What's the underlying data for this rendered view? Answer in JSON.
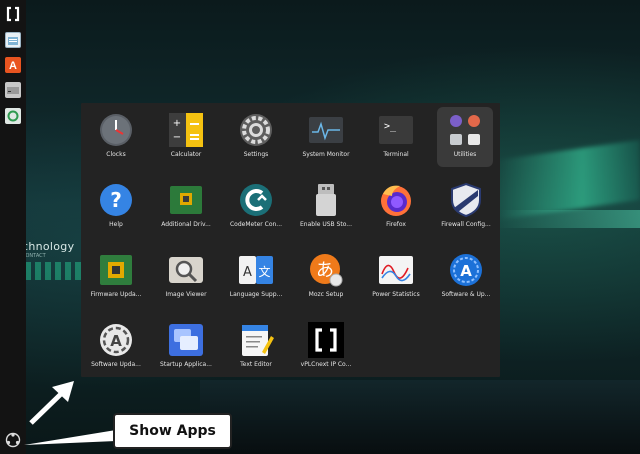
{
  "wallpaper": {
    "brand_text": "chnology",
    "sub_text": "CONTACT"
  },
  "dock": {
    "items": [
      {
        "name": "vPLCnext",
        "icon": "vplcnext-logo-icon"
      },
      {
        "name": "Files",
        "icon": "files-icon"
      },
      {
        "name": "Ubuntu Software",
        "icon": "ubuntu-store-icon"
      },
      {
        "name": "Drive",
        "icon": "disk-icon"
      },
      {
        "name": "Trash",
        "icon": "trash-icon"
      }
    ],
    "show_apps_icon": "show-apps-icon"
  },
  "apps": [
    {
      "label": "Clocks",
      "icon": "clock-icon"
    },
    {
      "label": "Calculator",
      "icon": "calculator-icon"
    },
    {
      "label": "Settings",
      "icon": "gear-icon"
    },
    {
      "label": "System Monitor",
      "icon": "system-monitor-icon"
    },
    {
      "label": "Terminal",
      "icon": "terminal-icon"
    },
    {
      "label": "Utilities",
      "icon": "folder-group-icon",
      "selected": true
    },
    {
      "label": "Help",
      "icon": "help-icon"
    },
    {
      "label": "Additional Driv...",
      "icon": "chip-icon"
    },
    {
      "label": "CodeMeter Con...",
      "icon": "codemeter-icon"
    },
    {
      "label": "Enable USB Sto...",
      "icon": "usb-icon"
    },
    {
      "label": "Firefox",
      "icon": "firefox-icon"
    },
    {
      "label": "Firewall Config...",
      "icon": "shield-icon"
    },
    {
      "label": "Firmware Upda...",
      "icon": "chip-icon"
    },
    {
      "label": "Image Viewer",
      "icon": "image-viewer-icon"
    },
    {
      "label": "Language Supp...",
      "icon": "language-icon"
    },
    {
      "label": "Mozc Setup",
      "icon": "mozc-icon"
    },
    {
      "label": "Power Statistics",
      "icon": "power-statistics-icon"
    },
    {
      "label": "Software & Up...",
      "icon": "software-updates-icon"
    },
    {
      "label": "Software Upda...",
      "icon": "software-updater-icon"
    },
    {
      "label": "Startup Applica...",
      "icon": "startup-apps-icon"
    },
    {
      "label": "Text Editor",
      "icon": "text-editor-icon"
    },
    {
      "label": "vPLCnext IP Co...",
      "icon": "vplcnext-icon"
    }
  ],
  "callout": {
    "label": "Show Apps"
  },
  "colors": {
    "overlay_bg": "#232323",
    "accent_orange": "#e95420"
  }
}
